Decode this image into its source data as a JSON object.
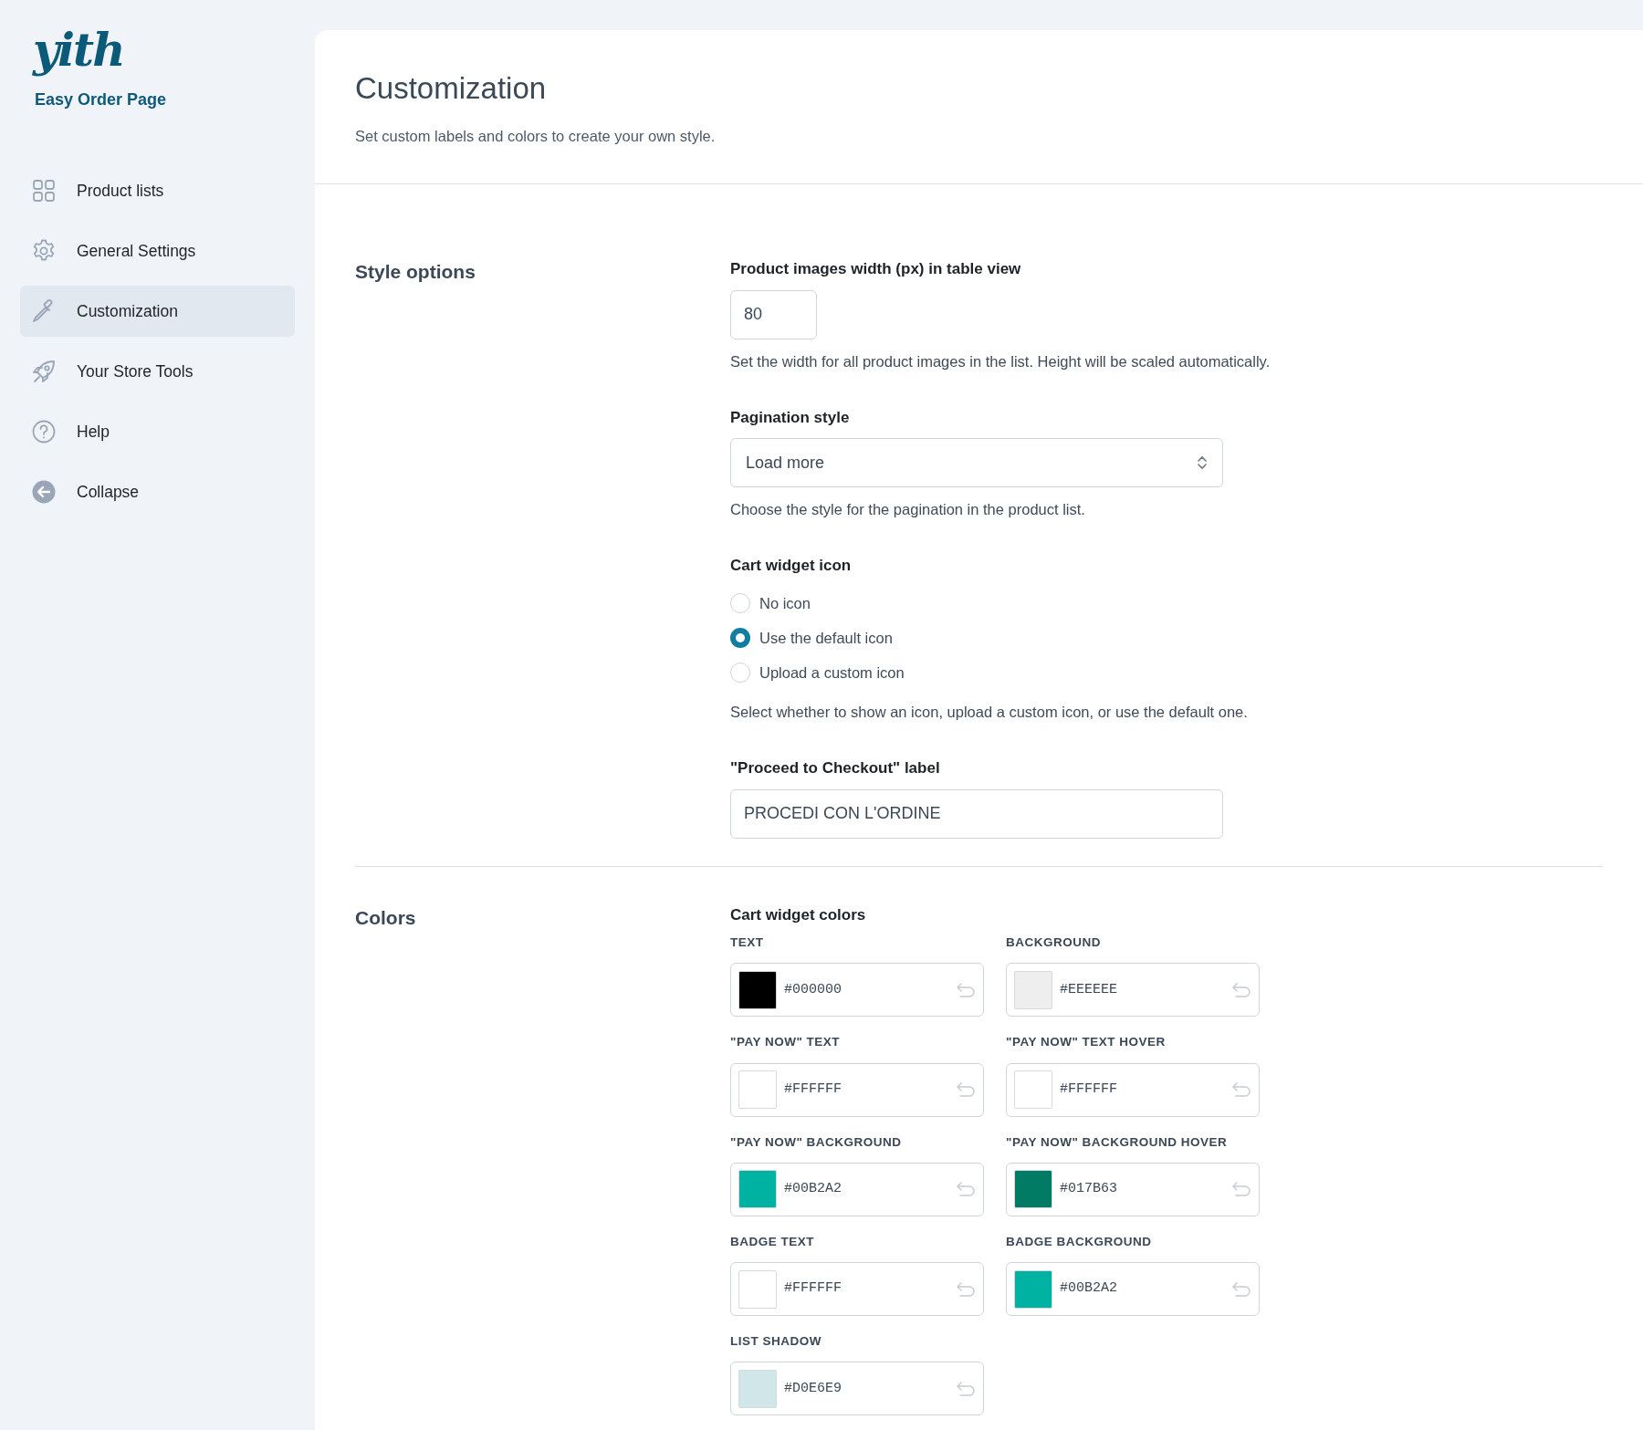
{
  "sidebar": {
    "logo": "yith",
    "product": "Easy Order Page",
    "items": [
      {
        "kind": "grid",
        "label": "Product lists",
        "selected": false
      },
      {
        "kind": "gear",
        "label": "General Settings",
        "selected": false
      },
      {
        "kind": "dropper",
        "label": "Customization",
        "selected": true
      },
      {
        "kind": "rocket",
        "label": "Your Store Tools",
        "selected": false
      },
      {
        "kind": "help",
        "label": "Help",
        "selected": false
      },
      {
        "kind": "collapse",
        "label": "Collapse",
        "selected": false
      }
    ]
  },
  "header": {
    "title": "Customization",
    "subtitle": "Set custom labels and colors to create your own style."
  },
  "sections": [
    {
      "title": "Style options",
      "fields": [
        {
          "kind": "number",
          "label": "Product images width (px) in table view",
          "value": "80",
          "description": "Set the width for all product images in the list. Height will be scaled automatically."
        },
        {
          "kind": "select",
          "label": "Pagination style",
          "value": "Load more",
          "description": "Choose the style for the pagination in the product list."
        },
        {
          "kind": "radio",
          "label": "Cart widget icon",
          "options": [
            {
              "label": "No icon",
              "selected": false
            },
            {
              "label": "Use the default icon",
              "selected": true
            },
            {
              "label": "Upload a custom icon",
              "selected": false
            }
          ],
          "description": "Select whether to show an icon, upload a custom icon, or use the default one."
        },
        {
          "kind": "text",
          "label": "\"Proceed to Checkout\" label",
          "value": "PROCEDI CON L'ORDINE"
        }
      ]
    },
    {
      "title": "Colors",
      "fields": [
        {
          "kind": "colors",
          "label": "Cart widget colors",
          "swatches": [
            {
              "label": "TEXT",
              "value": "#000000",
              "color": "#000000"
            },
            {
              "label": "BACKGROUND",
              "value": "#EEEEEE",
              "color": "#eeeeee"
            },
            {
              "label": "\"PAY NOW\" TEXT",
              "value": "#FFFFFF",
              "color": "#ffffff"
            },
            {
              "label": "\"PAY NOW\" TEXT HOVER",
              "value": "#FFFFFF",
              "color": "#ffffff"
            },
            {
              "label": "\"PAY NOW\" BACKGROUND",
              "value": "#00B2A2",
              "color": "#00b2a2"
            },
            {
              "label": "\"PAY NOW\" BACKGROUND HOVER",
              "value": "#017B63",
              "color": "#017b63"
            },
            {
              "label": "BADGE TEXT",
              "value": "#FFFFFF",
              "color": "#ffffff"
            },
            {
              "label": "BADGE BACKGROUND",
              "value": "#00B2A2",
              "color": "#00b2a2"
            },
            {
              "label": "LIST SHADOW",
              "value": "#D0E6E9",
              "color": "#d0e6e9"
            }
          ]
        }
      ]
    }
  ]
}
